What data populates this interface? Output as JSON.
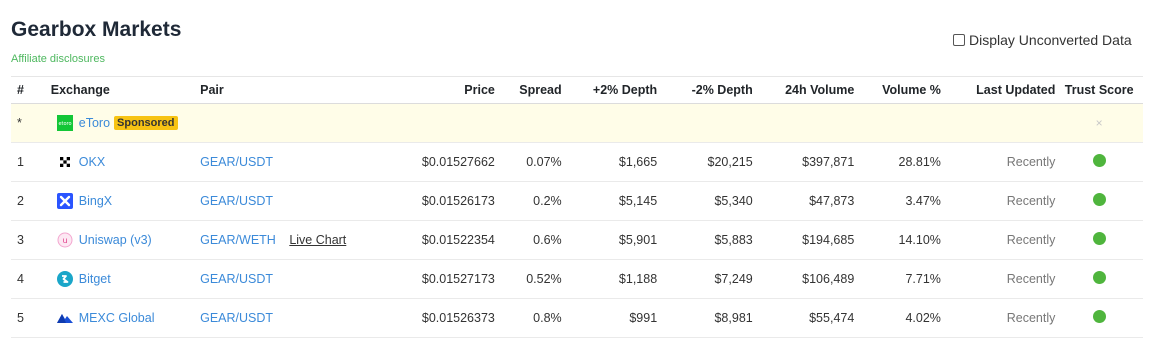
{
  "header": {
    "title": "Gearbox Markets",
    "affiliate_link": "Affiliate disclosures",
    "unconverted_label": "Display Unconverted Data"
  },
  "table": {
    "columns": {
      "num": "#",
      "exchange": "Exchange",
      "pair": "Pair",
      "price": "Price",
      "spread": "Spread",
      "depth_plus": "+2% Depth",
      "depth_minus": "-2% Depth",
      "volume_24h": "24h Volume",
      "volume_pct": "Volume %",
      "last_updated": "Last Updated",
      "trust_score": "Trust Score"
    },
    "sponsored": {
      "num": "*",
      "exchange": "eToro",
      "badge": "Sponsored",
      "trust": "×"
    },
    "rows": [
      {
        "num": "1",
        "exchange": "OKX",
        "pair": "GEAR/USDT",
        "live_chart": "",
        "price": "$0.01527662",
        "spread": "0.07%",
        "depth_plus": "$1,665",
        "depth_minus": "$20,215",
        "volume_24h": "$397,871",
        "volume_pct": "28.81%",
        "last_updated": "Recently",
        "trust_color": "#4fb53d"
      },
      {
        "num": "2",
        "exchange": "BingX",
        "pair": "GEAR/USDT",
        "live_chart": "",
        "price": "$0.01526173",
        "spread": "0.2%",
        "depth_plus": "$5,145",
        "depth_minus": "$5,340",
        "volume_24h": "$47,873",
        "volume_pct": "3.47%",
        "last_updated": "Recently",
        "trust_color": "#4fb53d"
      },
      {
        "num": "3",
        "exchange": "Uniswap (v3)",
        "pair": "GEAR/WETH",
        "live_chart": "Live Chart",
        "price": "$0.01522354",
        "spread": "0.6%",
        "depth_plus": "$5,901",
        "depth_minus": "$5,883",
        "volume_24h": "$194,685",
        "volume_pct": "14.10%",
        "last_updated": "Recently",
        "trust_color": "#4fb53d"
      },
      {
        "num": "4",
        "exchange": "Bitget",
        "pair": "GEAR/USDT",
        "live_chart": "",
        "price": "$0.01527173",
        "spread": "0.52%",
        "depth_plus": "$1,188",
        "depth_minus": "$7,249",
        "volume_24h": "$106,489",
        "volume_pct": "7.71%",
        "last_updated": "Recently",
        "trust_color": "#4fb53d"
      },
      {
        "num": "5",
        "exchange": "MEXC Global",
        "pair": "GEAR/USDT",
        "live_chart": "",
        "price": "$0.01526373",
        "spread": "0.8%",
        "depth_plus": "$991",
        "depth_minus": "$8,981",
        "volume_24h": "$55,474",
        "volume_pct": "4.02%",
        "last_updated": "Recently",
        "trust_color": "#4fb53d"
      }
    ]
  }
}
